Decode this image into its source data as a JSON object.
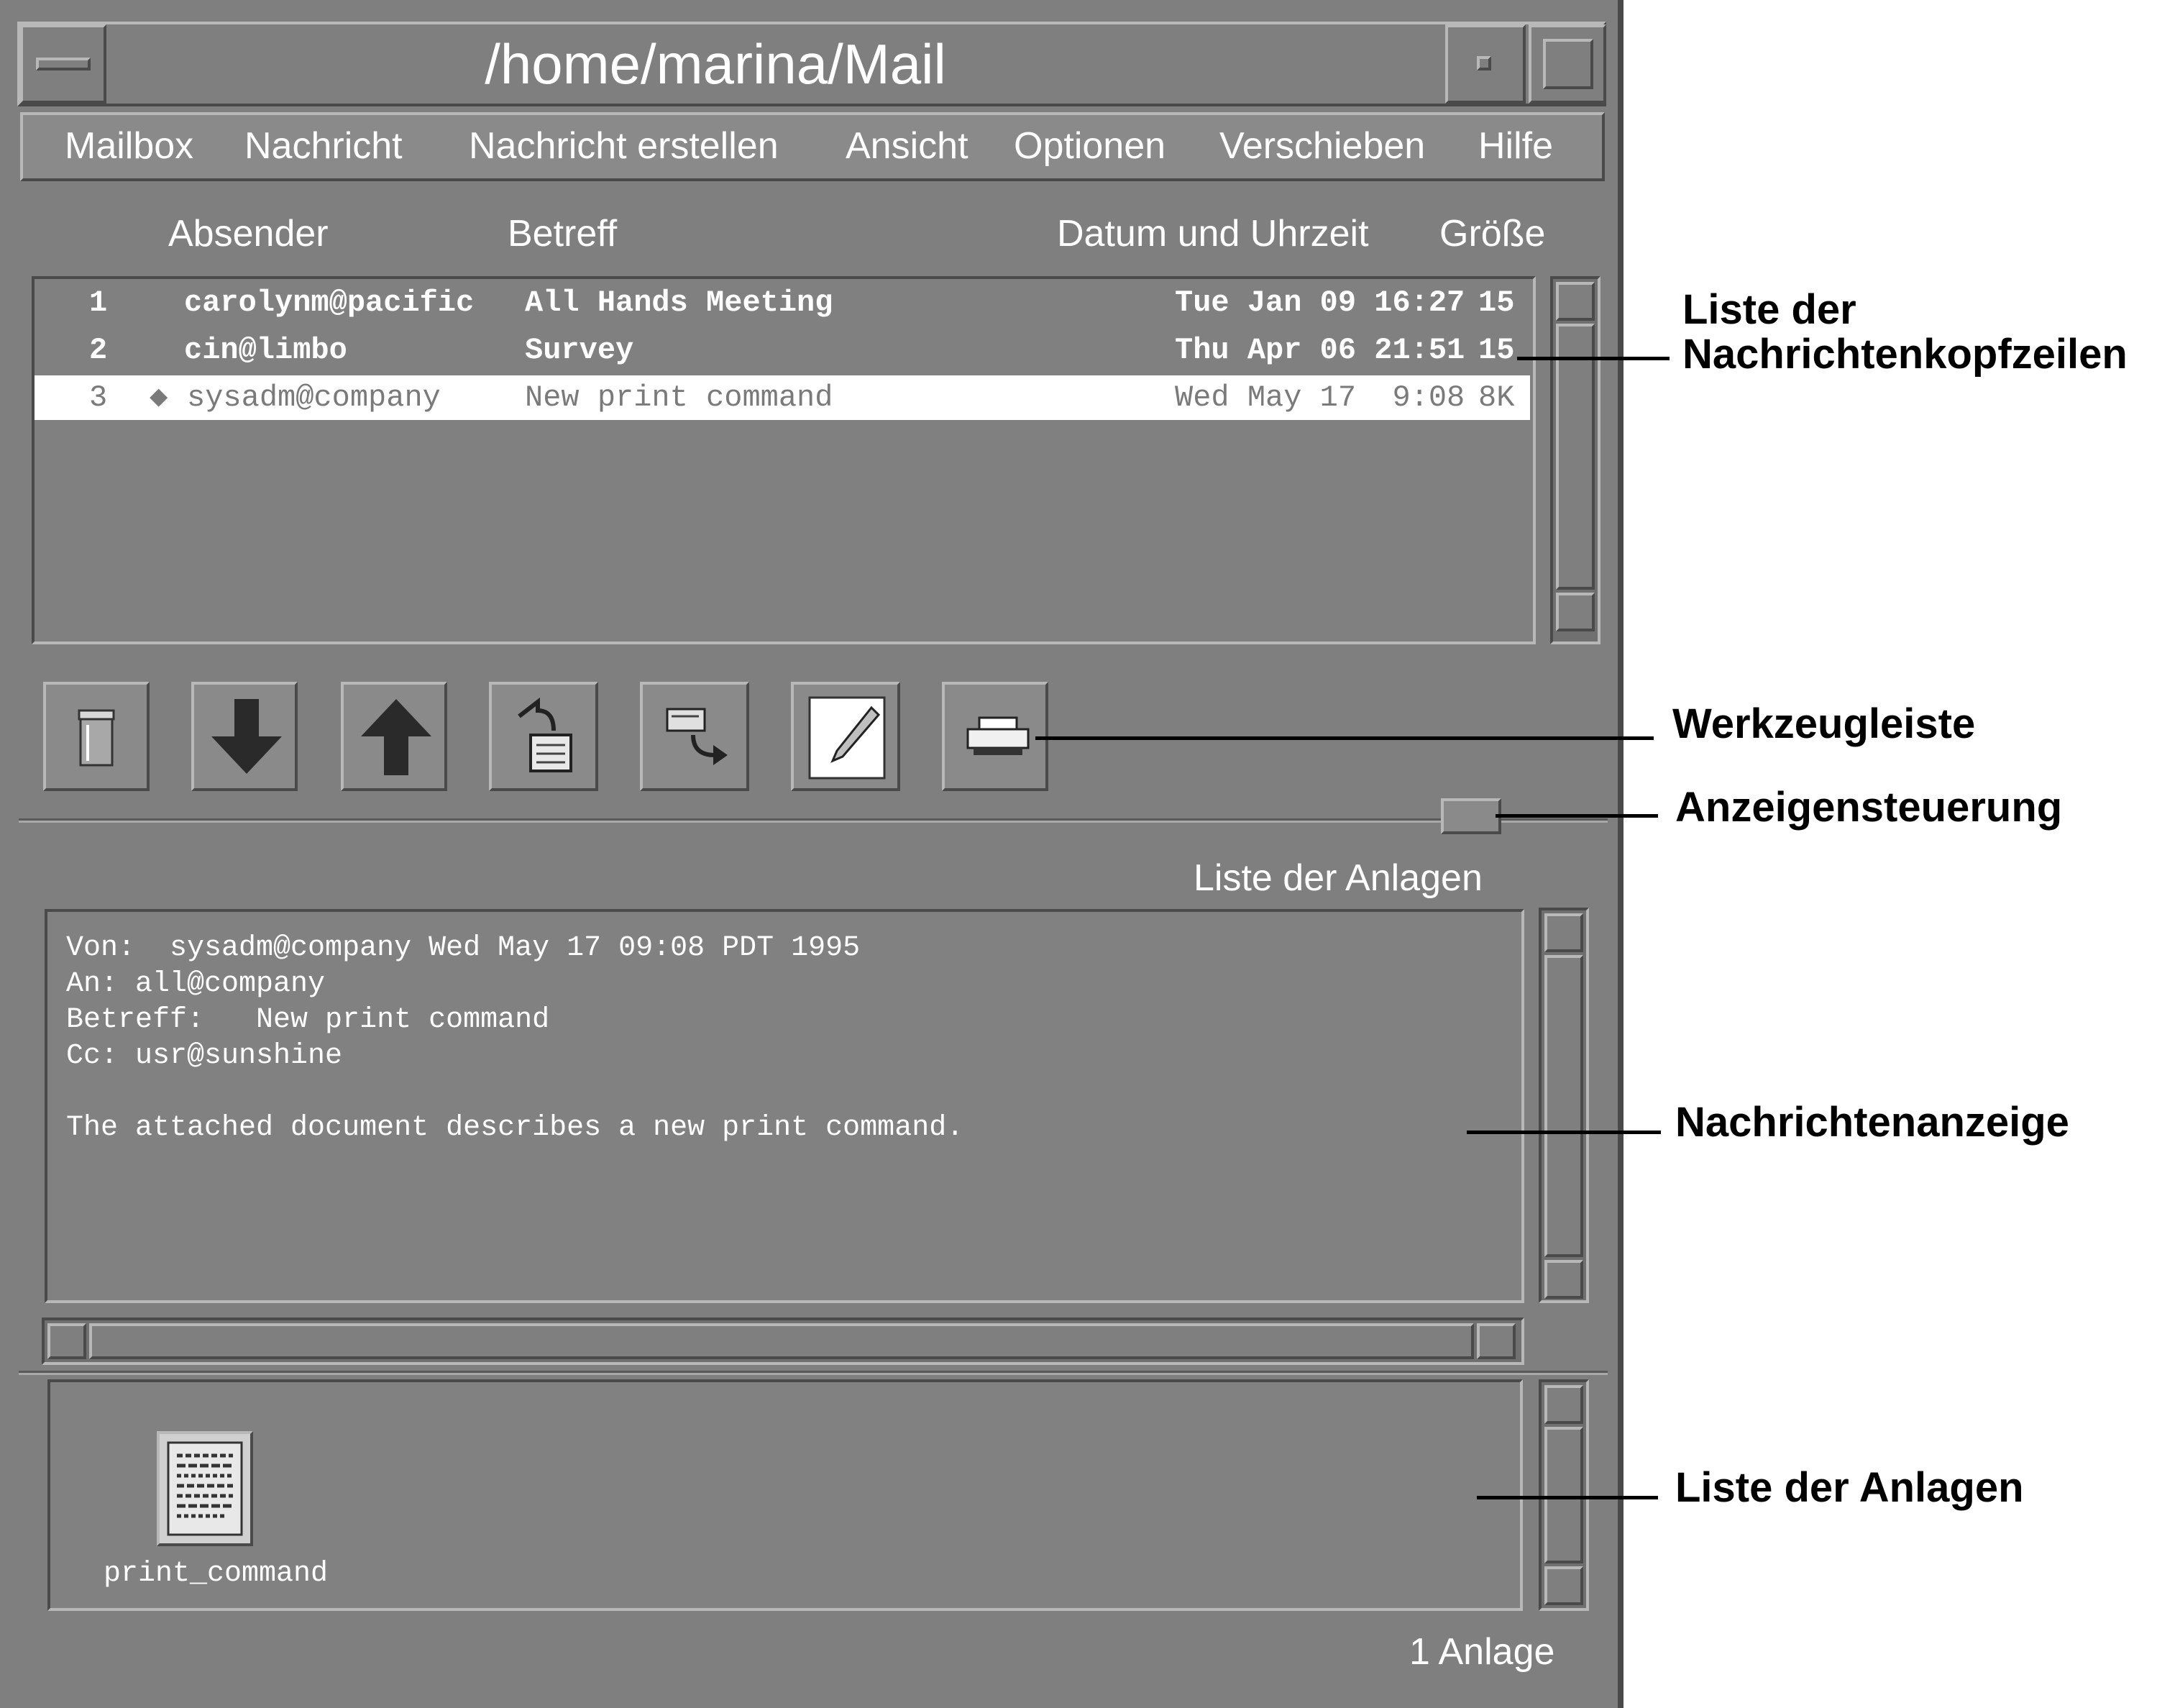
{
  "window": {
    "title": "/home/marina/Mail"
  },
  "menu": [
    "Mailbox",
    "Nachricht",
    "Nachricht erstellen",
    "Ansicht",
    "Optionen",
    "Verschieben",
    "Hilfe"
  ],
  "columns": {
    "sender": "Absender",
    "subject": "Betreff",
    "date": "Datum und Uhrzeit",
    "size": "Größe"
  },
  "messages": [
    {
      "num": "1",
      "flag": "",
      "sender": "carolynm@pacific",
      "subject": "All Hands Meeting",
      "date": "Tue Jan 09 16:27",
      "size": "15"
    },
    {
      "num": "2",
      "flag": "",
      "sender": "cin@limbo",
      "subject": "Survey",
      "date": "Thu Apr 06 21:51",
      "size": "15"
    },
    {
      "num": "3",
      "flag": "◆",
      "sender": "sysadm@company",
      "subject": "New print command",
      "date": "Wed May 17  9:08",
      "size": "8K"
    }
  ],
  "toolbar": [
    {
      "icon": "trash-icon"
    },
    {
      "icon": "arrow-down-icon"
    },
    {
      "icon": "arrow-up-icon"
    },
    {
      "icon": "reply-icon"
    },
    {
      "icon": "forward-icon"
    },
    {
      "icon": "compose-icon"
    },
    {
      "icon": "printer-icon"
    }
  ],
  "attachments_label": "Liste der Anlagen",
  "message": {
    "from": "Von:  sysadm@company Wed May 17 09:08 PDT 1995",
    "to": "An: all@company",
    "subject": "Betreff:   New print command",
    "cc": "Cc: usr@sunshine",
    "body": "The attached document describes a new print command."
  },
  "attachment": {
    "name": "print_command",
    "icon": "document-icon"
  },
  "status": "1 Anlage",
  "callouts": {
    "headers": "Liste der Nachrichtenkopfzeilen",
    "toolbar": "Werkzeugleiste",
    "display_control": "Anzeigensteuerung",
    "message_display": "Nachrichtenanzeige",
    "attachments": "Liste der Anlagen"
  }
}
